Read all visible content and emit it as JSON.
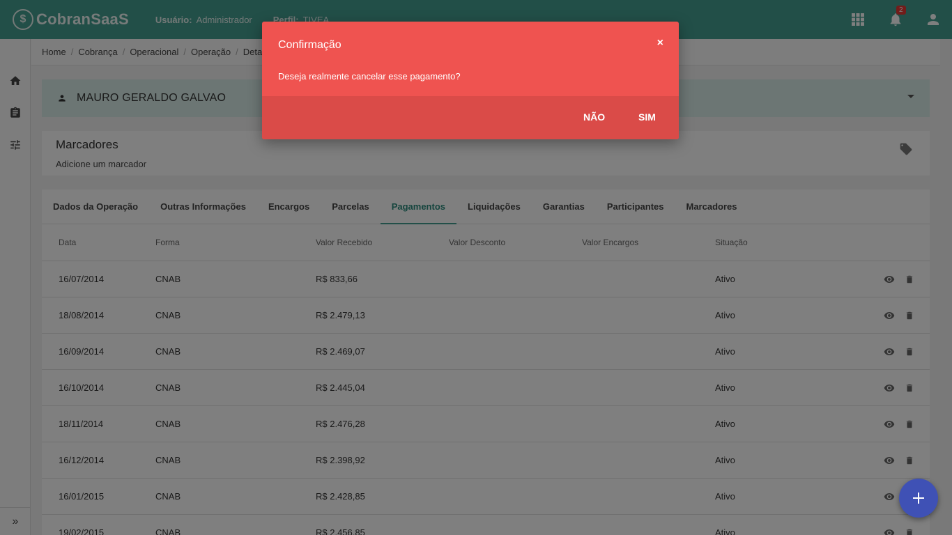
{
  "header": {
    "app_name": "CobranSaaS",
    "logo_letter": "$",
    "user_label": "Usuário:",
    "user_value": "Administrador",
    "profile_label": "Perfil:",
    "profile_value": "TIVEA",
    "notifications_count": "2",
    "color": "#449e90"
  },
  "breadcrumb": [
    "Home",
    "Cobrança",
    "Operacional",
    "Operação",
    "Deta"
  ],
  "person": {
    "name": "MAURO GERALDO GALVAO"
  },
  "markers": {
    "title": "Marcadores",
    "subtitle": "Adicione um marcador"
  },
  "tabs": [
    "Dados da Operação",
    "Outras Informações",
    "Encargos",
    "Parcelas",
    "Pagamentos",
    "Liquidações",
    "Garantias",
    "Participantes",
    "Marcadores"
  ],
  "active_tab": "Pagamentos",
  "table": {
    "columns": [
      "Data",
      "Forma",
      "Valor Recebido",
      "Valor Desconto",
      "Valor Encargos",
      "Situação"
    ],
    "rows": [
      [
        "16/07/2014",
        "CNAB",
        "R$ 833,66",
        "",
        "",
        "Ativo"
      ],
      [
        "18/08/2014",
        "CNAB",
        "R$ 2.479,13",
        "",
        "",
        "Ativo"
      ],
      [
        "16/09/2014",
        "CNAB",
        "R$ 2.469,07",
        "",
        "",
        "Ativo"
      ],
      [
        "16/10/2014",
        "CNAB",
        "R$ 2.445,04",
        "",
        "",
        "Ativo"
      ],
      [
        "18/11/2014",
        "CNAB",
        "R$ 2.476,28",
        "",
        "",
        "Ativo"
      ],
      [
        "16/12/2014",
        "CNAB",
        "R$ 2.398,92",
        "",
        "",
        "Ativo"
      ],
      [
        "16/01/2015",
        "CNAB",
        "R$ 2.428,85",
        "",
        "",
        "Ativo"
      ],
      [
        "19/02/2015",
        "CNAB",
        "R$ 2.456,85",
        "",
        "",
        "Ativo"
      ]
    ]
  },
  "dialog": {
    "title": "Confirmação",
    "close": "×",
    "message": "Deseja realmente cancelar esse pagamento?",
    "no_label": "NÃO",
    "yes_label": "SIM",
    "color": "#ef5350"
  },
  "sidebar": {
    "expand_label": "»"
  },
  "fab": {
    "label": "+",
    "color": "#3f51b5"
  }
}
